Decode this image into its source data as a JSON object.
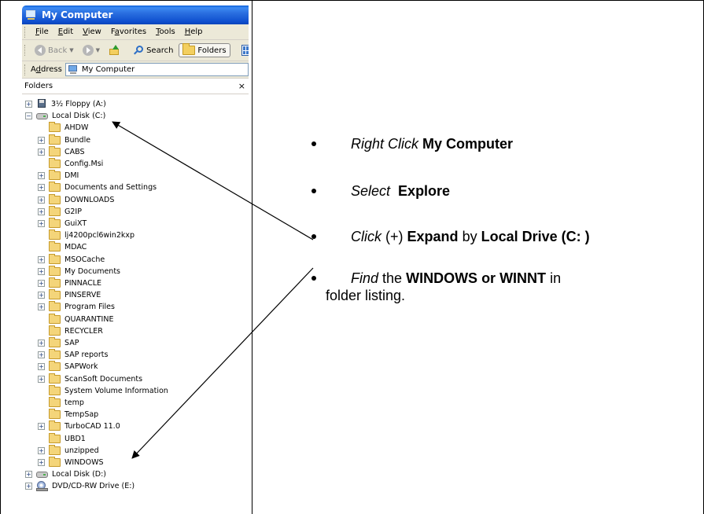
{
  "window": {
    "title": "My Computer"
  },
  "menu": [
    {
      "label": "File",
      "key": "F",
      "rest": "ile"
    },
    {
      "label": "Edit",
      "key": "E",
      "rest": "dit"
    },
    {
      "label": "View",
      "key": "V",
      "rest": "iew"
    },
    {
      "label": "Favorites",
      "key": "a",
      "pre": "F",
      "rest": "vorites"
    },
    {
      "label": "Tools",
      "key": "T",
      "rest": "ools"
    },
    {
      "label": "Help",
      "key": "H",
      "rest": "elp"
    }
  ],
  "toolbar": {
    "back_label": "Back",
    "search_label": "Search",
    "folders_label": "Folders"
  },
  "address": {
    "label_pre": "A",
    "label_key": "d",
    "label_rest": "dress",
    "value": "My Computer"
  },
  "folders_pane": {
    "header": "Folders",
    "close_glyph": "×"
  },
  "tree": [
    {
      "label": "3½ Floppy (A:)",
      "level": 0,
      "icon": "floppy-icon",
      "expander": "+"
    },
    {
      "label": "Local Disk (C:)",
      "level": 0,
      "icon": "drive-icon",
      "expander": "−"
    },
    {
      "label": "AHDW",
      "level": 1,
      "icon": "folder-icon",
      "expander": ""
    },
    {
      "label": "Bundle",
      "level": 1,
      "icon": "folder-icon",
      "expander": "+"
    },
    {
      "label": "CABS",
      "level": 1,
      "icon": "folder-icon",
      "expander": "+"
    },
    {
      "label": "Config.Msi",
      "level": 1,
      "icon": "folder-icon",
      "expander": ""
    },
    {
      "label": "DMI",
      "level": 1,
      "icon": "folder-icon",
      "expander": "+"
    },
    {
      "label": "Documents and Settings",
      "level": 1,
      "icon": "folder-icon",
      "expander": "+"
    },
    {
      "label": "DOWNLOADS",
      "level": 1,
      "icon": "folder-icon",
      "expander": "+"
    },
    {
      "label": "G2IP",
      "level": 1,
      "icon": "folder-icon",
      "expander": "+"
    },
    {
      "label": "GuiXT",
      "level": 1,
      "icon": "folder-icon",
      "expander": "+"
    },
    {
      "label": "lj4200pcl6win2kxp",
      "level": 1,
      "icon": "folder-icon",
      "expander": ""
    },
    {
      "label": "MDAC",
      "level": 1,
      "icon": "folder-icon",
      "expander": ""
    },
    {
      "label": "MSOCache",
      "level": 1,
      "icon": "folder-icon",
      "expander": "+"
    },
    {
      "label": "My Documents",
      "level": 1,
      "icon": "folder-icon",
      "expander": "+"
    },
    {
      "label": "PINNACLE",
      "level": 1,
      "icon": "folder-icon",
      "expander": "+"
    },
    {
      "label": "PINSERVE",
      "level": 1,
      "icon": "folder-icon",
      "expander": "+"
    },
    {
      "label": "Program Files",
      "level": 1,
      "icon": "folder-icon",
      "expander": "+"
    },
    {
      "label": "QUARANTINE",
      "level": 1,
      "icon": "folder-icon",
      "expander": ""
    },
    {
      "label": "RECYCLER",
      "level": 1,
      "icon": "folder-icon",
      "expander": ""
    },
    {
      "label": "SAP",
      "level": 1,
      "icon": "folder-icon",
      "expander": "+"
    },
    {
      "label": "SAP reports",
      "level": 1,
      "icon": "folder-icon",
      "expander": "+"
    },
    {
      "label": "SAPWork",
      "level": 1,
      "icon": "folder-icon",
      "expander": "+"
    },
    {
      "label": "ScanSoft Documents",
      "level": 1,
      "icon": "folder-icon",
      "expander": "+"
    },
    {
      "label": "System Volume Information",
      "level": 1,
      "icon": "folder-icon",
      "expander": ""
    },
    {
      "label": "temp",
      "level": 1,
      "icon": "folder-icon",
      "expander": ""
    },
    {
      "label": "TempSap",
      "level": 1,
      "icon": "folder-icon",
      "expander": ""
    },
    {
      "label": "TurboCAD 11.0",
      "level": 1,
      "icon": "folder-icon",
      "expander": "+"
    },
    {
      "label": "UBD1",
      "level": 1,
      "icon": "folder-icon",
      "expander": ""
    },
    {
      "label": "unzipped",
      "level": 1,
      "icon": "folder-icon",
      "expander": "+"
    },
    {
      "label": "WINDOWS",
      "level": 1,
      "icon": "folder-icon",
      "expander": "+"
    },
    {
      "label": "Local Disk (D:)",
      "level": 0,
      "icon": "drive-icon",
      "expander": "+"
    },
    {
      "label": "DVD/CD-RW Drive (E:)",
      "level": 0,
      "icon": "dvd-icon",
      "expander": "+"
    }
  ],
  "instructions": [
    {
      "italic": "Right Click",
      "mid": "",
      "bold": "My Computer",
      "tail": "",
      "bold2": "",
      "line2": ""
    },
    {
      "italic": "Select",
      "mid": "",
      "bold": "Explore",
      "tail": "",
      "bold2": "",
      "line2": ""
    },
    {
      "italic": "Click",
      "mid": "(+)",
      "bold": "Expand",
      "tail": "by",
      "bold2": "Local Drive (C: )",
      "line2": ""
    },
    {
      "italic": "Find",
      "mid": "the",
      "bold": "WINDOWS or WINNT",
      "tail": "in",
      "bold2": "",
      "line2": "folder listing."
    }
  ]
}
